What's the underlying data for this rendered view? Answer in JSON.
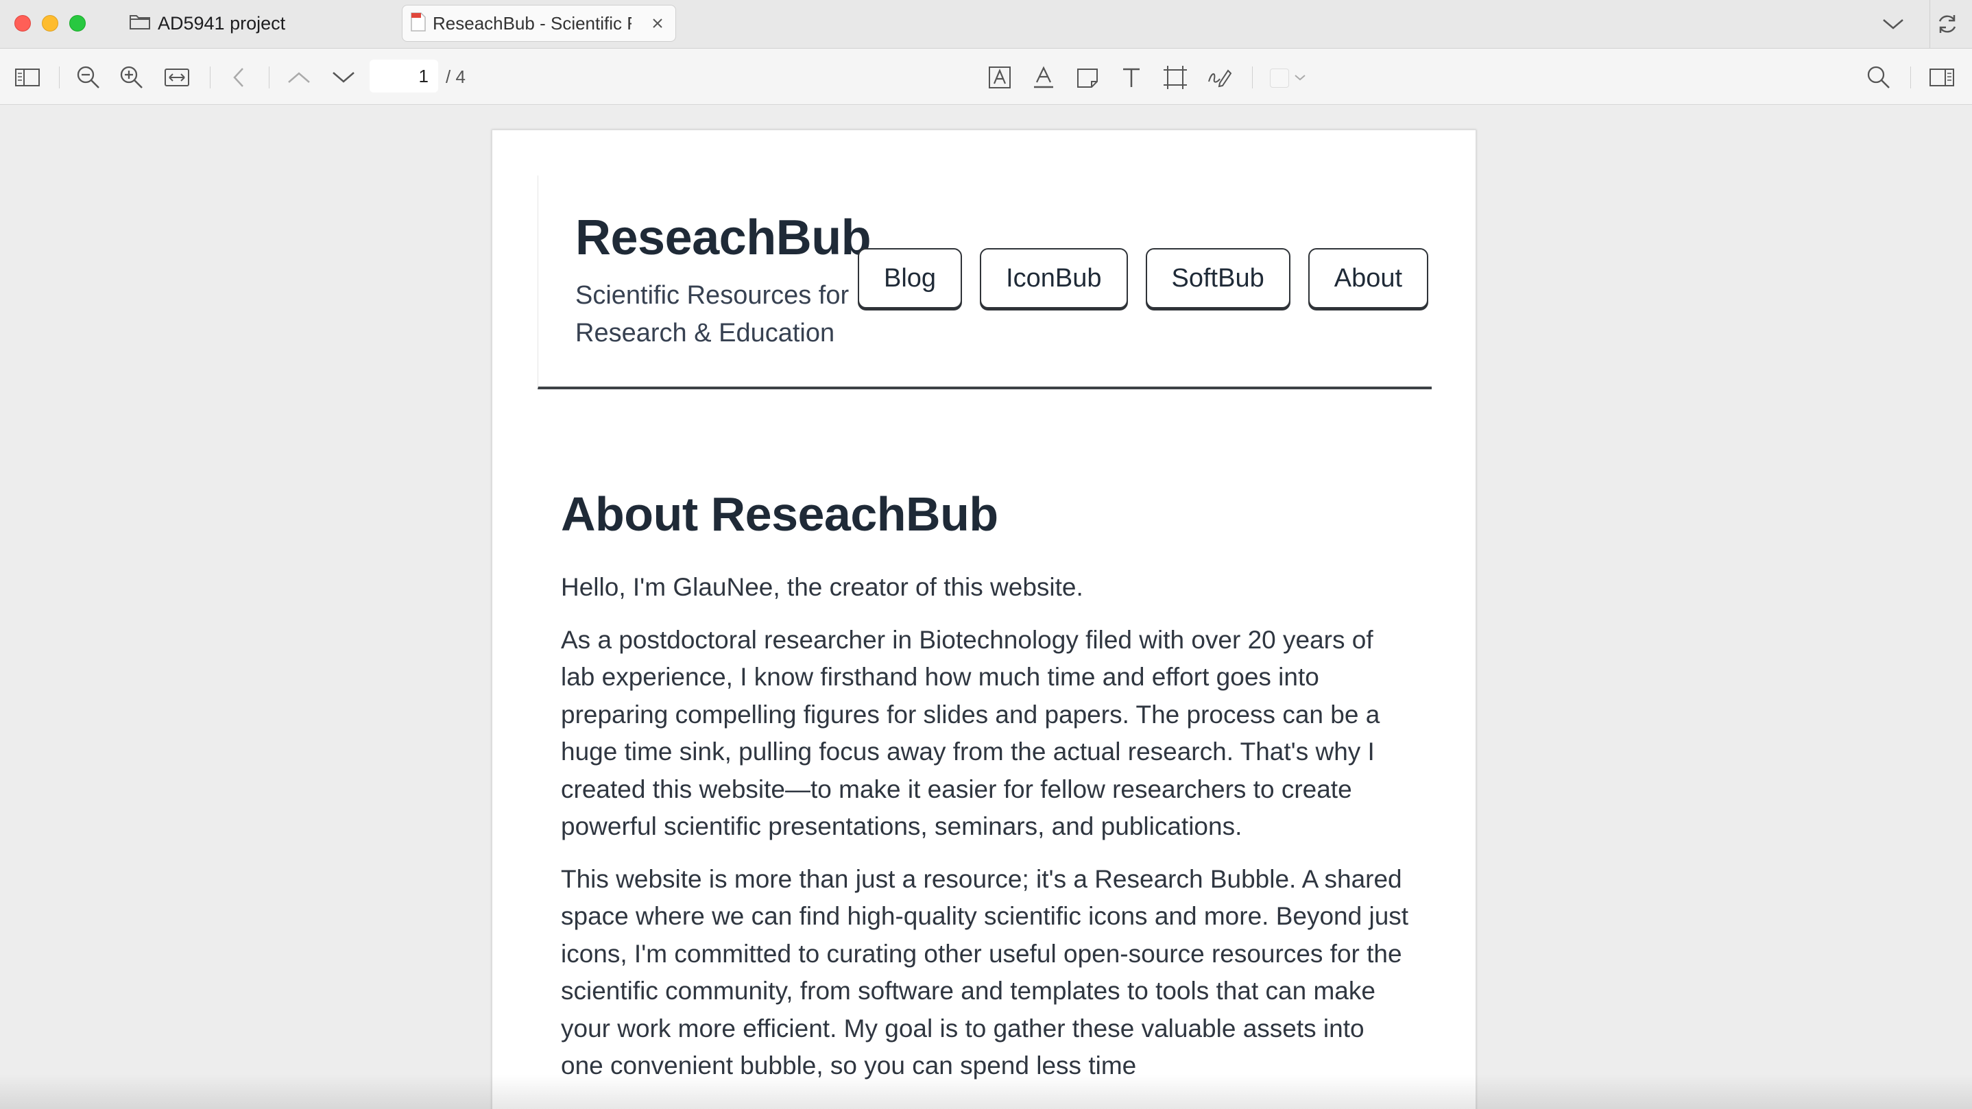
{
  "window": {
    "tabs": [
      {
        "label": "AD5941 project",
        "icon": "folder-icon",
        "active": false
      },
      {
        "label": "ReseachBub - Scientific Resources for Research & Education",
        "icon": "pdf-file-icon",
        "active": true
      }
    ]
  },
  "toolbar": {
    "current_page": "1",
    "total_pages": "/ 4"
  },
  "site": {
    "brand": "ReseachBub",
    "tagline": "Scientific Resources for Research & Education",
    "nav": [
      "Blog",
      "IconBub",
      "SoftBub",
      "About"
    ]
  },
  "article": {
    "heading": "About ReseachBub",
    "intro": "Hello, I'm GlauNee, the creator of this website.",
    "para1": "As a postdoctoral researcher in Biotechnology filed with over 20 years of lab experience, I know firsthand how much time and effort goes into preparing compelling figures for slides and papers. The process can be a huge time sink, pulling focus away from the actual research. That's why I created this website—to make it easier for fellow researchers to create powerful scientific presentations, seminars, and publications.",
    "para2": "This website is more than just a resource; it's a Research Bubble. A shared space where we can find high-quality scientific icons and more. Beyond just icons, I'm committed to curating other useful open-source resources for the scientific community, from software and templates to tools that can make your work more efficient. My goal is to gather these valuable assets into one convenient bubble, so you can spend less time"
  },
  "colors": {
    "close": "#ff5f57",
    "minimize": "#febc2e",
    "maximize": "#28c840",
    "text_dark": "#1f2a37"
  }
}
